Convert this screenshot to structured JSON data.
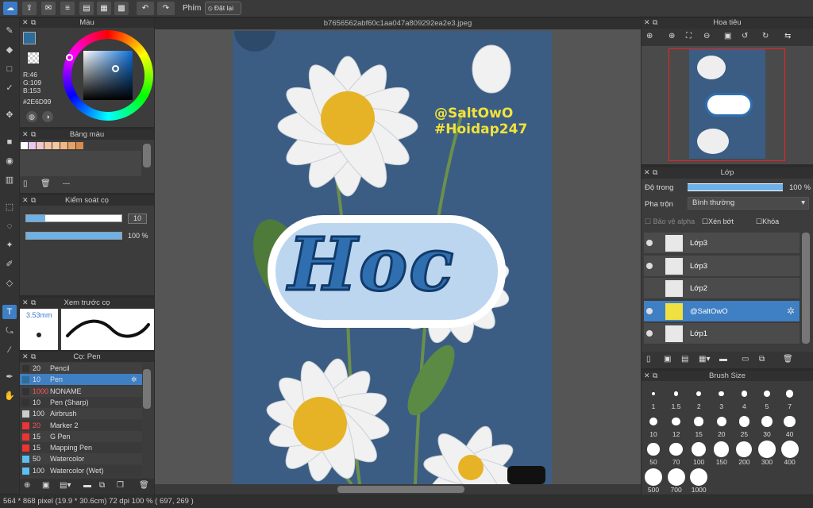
{
  "toolbar": {
    "phim_label": "Phím",
    "reset_label": "Đặt lại"
  },
  "document": {
    "filename": "b7656562abf60c1aa047a809292ea2e3.jpeg"
  },
  "color_panel": {
    "title": "Màu",
    "r": "R:46",
    "g": "G:109",
    "b": "B:153",
    "hex": "#2E6D99",
    "current_color": "#2E6D99"
  },
  "palette_panel": {
    "title": "Bảng màu",
    "empty_label": "---",
    "swatches": [
      "#ffffff",
      "#e7c9ef",
      "#f3c7c7",
      "#f0c4a6",
      "#f4c8a0",
      "#f0b785",
      "#e7a265",
      "#d88b4f"
    ]
  },
  "brush_control": {
    "title": "Kiểm soát cọ",
    "size_value": "10",
    "opacity_value": "100 %",
    "size_fraction": 0.2,
    "opacity_fraction": 1.0
  },
  "brush_preview": {
    "title": "Xem trước cọ",
    "size_label": "3.53mm"
  },
  "brush_list": {
    "title": "Cọ: Pen",
    "items": [
      {
        "size": "20",
        "name": "Pencil",
        "color": "#333333",
        "red": false
      },
      {
        "size": "10",
        "name": "Pen",
        "color": "#2e6d99",
        "red": false
      },
      {
        "size": "1000",
        "name": "NONAME",
        "color": "#333333",
        "red": true
      },
      {
        "size": "10",
        "name": "Pen (Sharp)",
        "color": "#333333",
        "red": false
      },
      {
        "size": "100",
        "name": "Airbrush",
        "color": "#cccccc",
        "red": false
      },
      {
        "size": "20",
        "name": "Marker 2",
        "color": "#e33",
        "red": true
      },
      {
        "size": "15",
        "name": "G Pen",
        "color": "#e33",
        "red": false
      },
      {
        "size": "15",
        "name": "Mapping Pen",
        "color": "#e33",
        "red": false
      },
      {
        "size": "50",
        "name": "Watercolor",
        "color": "#5bc0f0",
        "red": false
      },
      {
        "size": "100",
        "name": "Watercolor (Wet)",
        "color": "#5bc0f0",
        "red": false
      }
    ]
  },
  "artwork": {
    "watermark_line1": "@SaltOwO",
    "watermark_line2": "#Hoidap247",
    "title_text": "Hoc"
  },
  "navigator": {
    "title": "Hoa tiêu"
  },
  "layers_panel": {
    "title": "Lớp",
    "opacity_label": "Độ trong",
    "opacity_value": "100 %",
    "opacity_fraction": 1.0,
    "blend_label": "Pha trộn",
    "blend_value": "Bình thường",
    "alpha_protect": "Bảo vệ alpha",
    "clipping": "Xén bớt",
    "lock": "Khóa",
    "layers": [
      {
        "name": "Lớp3",
        "selected": false,
        "visible": true
      },
      {
        "name": "Lớp3",
        "selected": false,
        "visible": true
      },
      {
        "name": "Lớp2",
        "selected": false,
        "visible": false
      },
      {
        "name": "@SaltOwO",
        "selected": true,
        "visible": true
      },
      {
        "name": "Lớp1",
        "selected": false,
        "visible": true
      }
    ]
  },
  "brush_size_panel": {
    "title": "Brush Size",
    "sizes": [
      "1",
      "1.5",
      "2",
      "3",
      "4",
      "5",
      "7",
      "10",
      "12",
      "15",
      "20",
      "25",
      "30",
      "40",
      "50",
      "70",
      "100",
      "150",
      "200",
      "300",
      "400",
      "500",
      "700",
      "1000"
    ]
  },
  "status": {
    "text": "564 * 868 pixel  (19.9 * 30.6cm)  72 dpi  100 %  ( 697, 269 )"
  }
}
